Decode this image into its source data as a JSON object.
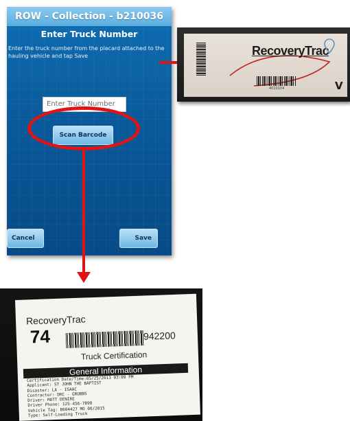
{
  "phone": {
    "title": "ROW - Collection - b210036",
    "heading": "Enter Truck Number",
    "instruction": "Enter the truck number from the placard attached to the hauling vehicle and tap Save",
    "truck_input_placeholder": "Enter Truck Number",
    "scan_button": "Scan Barcode",
    "cancel_button": "Cancel",
    "save_button": "Save"
  },
  "placard": {
    "logo_text": "RecoveryTrac",
    "barcode_number": "4010104",
    "corner_letter": "V"
  },
  "receipt": {
    "brand": "RecoveryTrac",
    "truck_number": "74",
    "barcode_text": "942200",
    "certification_title": "Truck Certification",
    "section_header": "General Information",
    "lines": [
      "Certification Date/Time:05/25/2013 03:09 PM",
      "Applicant: ST JOHN THE BAPTIST",
      "Disaster: LA - ISAAC",
      "Contractor: DRC - GRUBBS",
      "Driver: MATT DENIRE",
      "Driver Phone: 125-456-7890",
      "Vehicle Tag: B604427 MO 00/2015",
      "Type: Self-Loading Truck"
    ]
  },
  "colors": {
    "accent_red": "#e01414",
    "phone_blue": "#0a5a9b",
    "titlebar_blue": "#5aaee0"
  }
}
